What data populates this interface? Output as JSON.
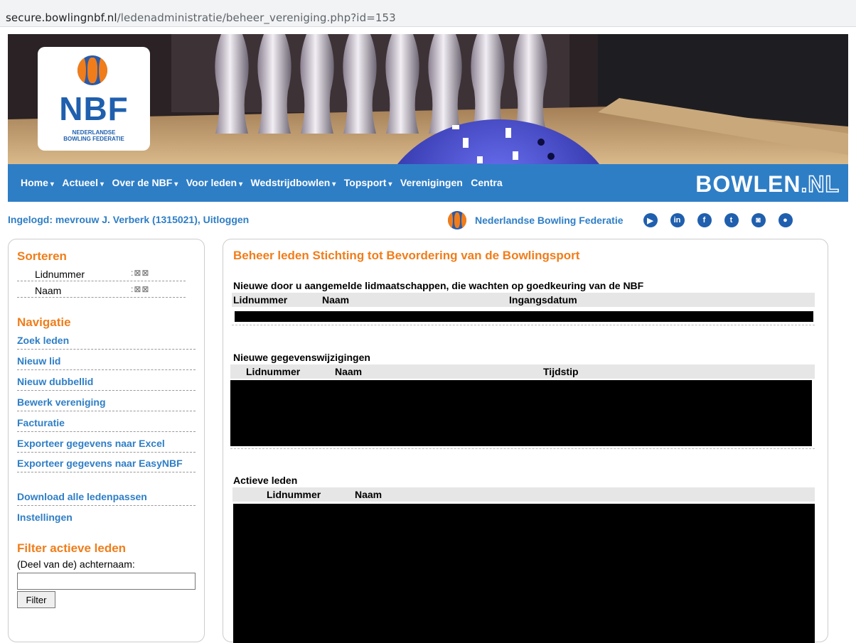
{
  "browser": {
    "url_host": "secure.bowlingnbf.nl",
    "url_path": "/ledenadministratie/beheer_vereniging.php?id=153"
  },
  "logo": {
    "acronym": "NBF",
    "subtitle_line1": "NEDERLANDSE",
    "subtitle_line2": "BOWLING FEDERATIE"
  },
  "nav": {
    "items": [
      {
        "label": "Home",
        "caret": "▾"
      },
      {
        "label": "Actueel",
        "caret": "▾"
      },
      {
        "label": "Over de NBF",
        "caret": "▾"
      },
      {
        "label": "Voor leden",
        "caret": "▾"
      },
      {
        "label": "Wedstrijdbowlen",
        "caret": "▾"
      },
      {
        "label": "Topsport",
        "caret": "▾"
      },
      {
        "label": "Verenigingen",
        "caret": ""
      },
      {
        "label": "Centra",
        "caret": ""
      }
    ],
    "brand_bold": "BOWLEN",
    "brand_dim": ".NL"
  },
  "header": {
    "logged_in_text": "Ingelogd: mevrouw J. Verberk (1315021), Uitloggen",
    "federation_name": "Nederlandse Bowling Federatie",
    "social_icons": [
      "youtube-icon",
      "linkedin-icon",
      "facebook-icon",
      "twitter-icon",
      "instagram-icon",
      "flickr-icon"
    ]
  },
  "sidebar": {
    "sort_heading": "Sorteren",
    "sort_items": [
      {
        "label": "Lidnummer",
        "arrows": ":⊠⊠"
      },
      {
        "label": "Naam",
        "arrows": ":⊠⊠"
      }
    ],
    "nav_heading": "Navigatie",
    "nav_links": [
      "Zoek leden",
      "Nieuw lid",
      "Nieuw dubbellid",
      "Bewerk vereniging",
      "Facturatie",
      "Exporteer gegevens naar Excel",
      "Exporteer gegevens naar EasyNBF",
      "Download alle ledenpassen",
      "Instellingen"
    ],
    "filter_heading": "Filter actieve leden",
    "filter_label": "(Deel van de) achternaam:",
    "filter_value": "",
    "filter_button": "Filter"
  },
  "main": {
    "title": "Beheer leden Stichting tot Bevordering van de Bowlingsport",
    "sections": [
      {
        "title": "Nieuwe door u aangemelde lidmaatschappen, die wachten op goedkeuring van de NBF",
        "columns": [
          "Lidnummer",
          "Naam",
          "Ingangsdatum"
        ]
      },
      {
        "title": "Nieuwe gegevenswijzigingen",
        "columns": [
          "Lidnummer",
          "Naam",
          "Tijdstip"
        ]
      },
      {
        "title": "Actieve leden",
        "columns": [
          "Lidnummer",
          "Naam"
        ]
      }
    ]
  },
  "colors": {
    "brand_blue": "#2e7ec6",
    "accent_orange": "#f07d1a",
    "redaction": "#000000"
  }
}
